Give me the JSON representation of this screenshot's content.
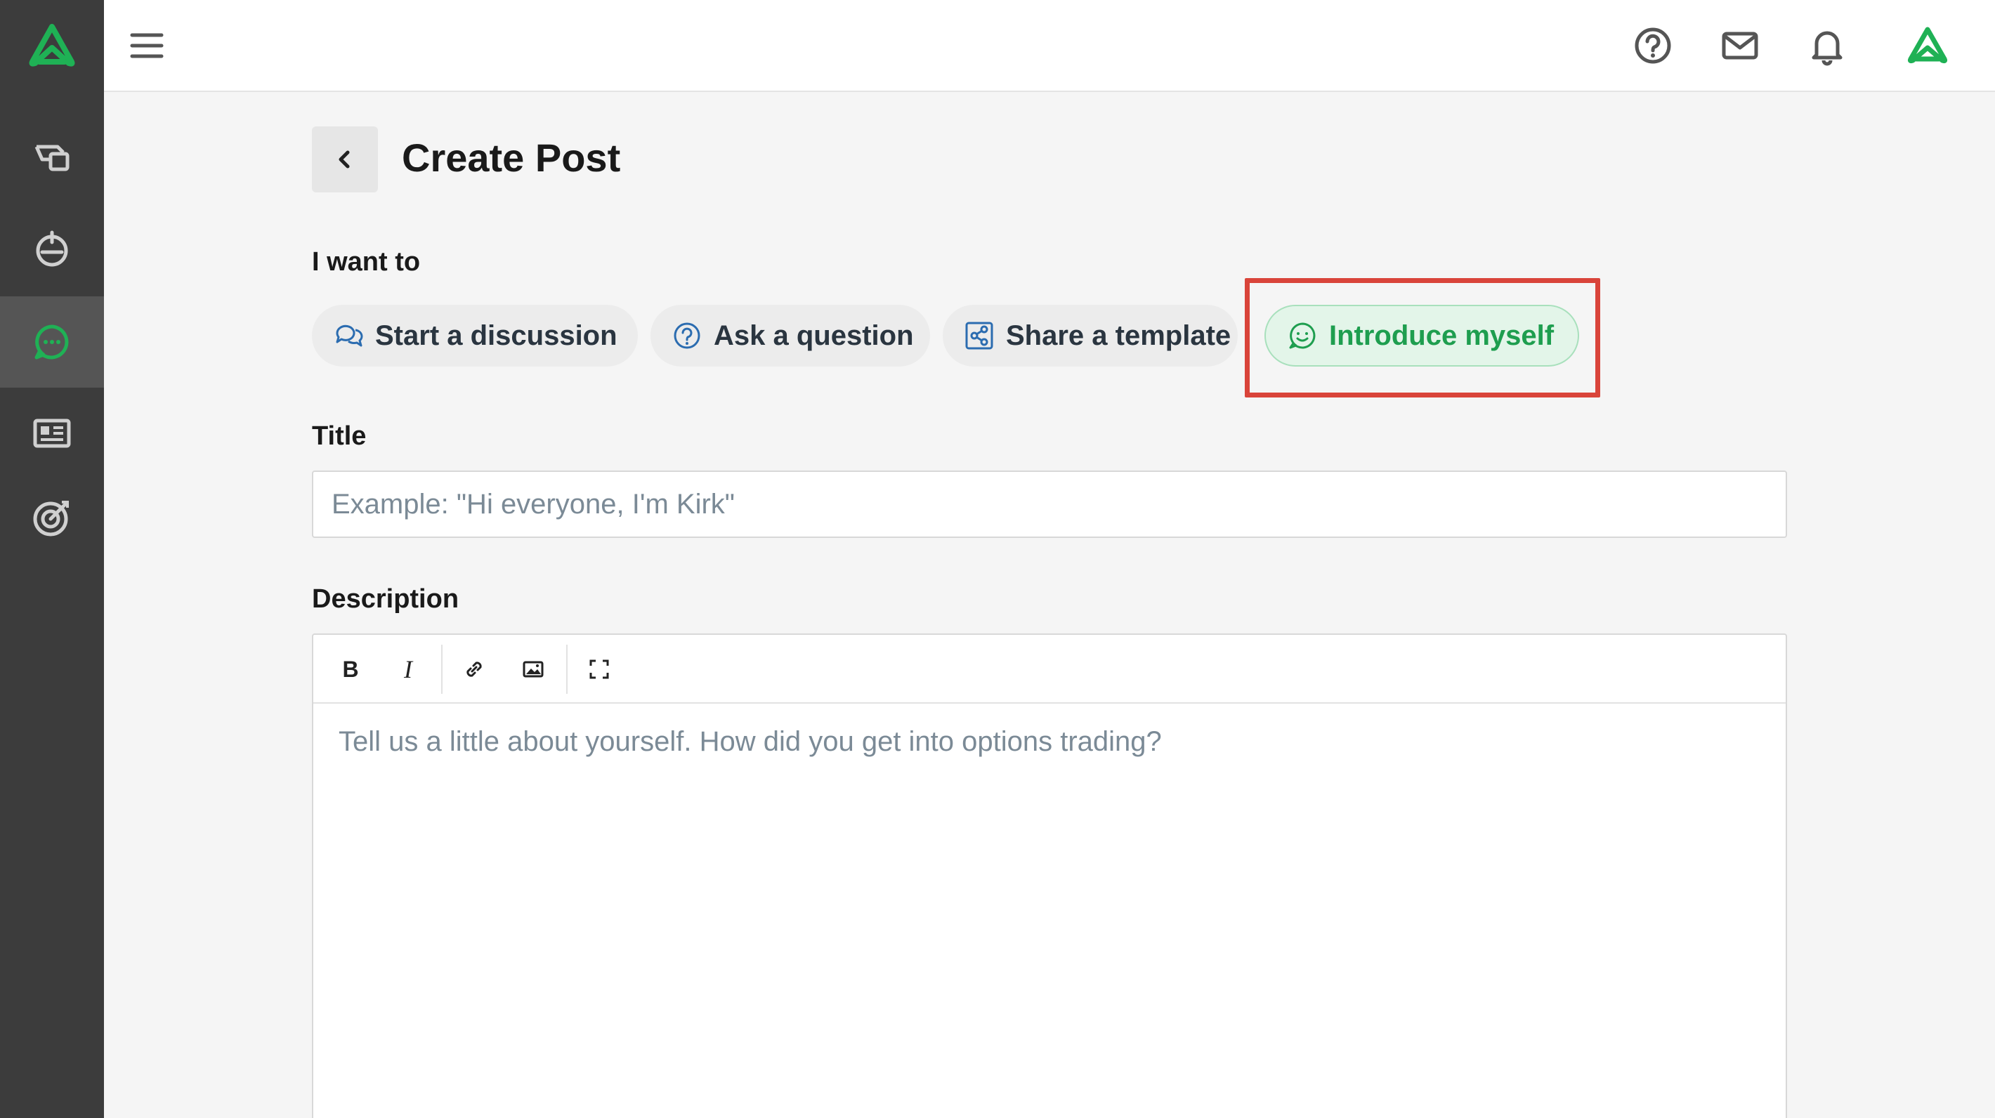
{
  "page": {
    "title": "Create Post",
    "i_want_to_label": "I want to"
  },
  "post_types": [
    {
      "label": "Start a discussion",
      "icon": "chat-bubbles-icon",
      "selected": false
    },
    {
      "label": "Ask a question",
      "icon": "question-circle-icon",
      "selected": false
    },
    {
      "label": "Share a template",
      "icon": "share-icon",
      "selected": false
    },
    {
      "label": "Introduce myself",
      "icon": "smile-chat-icon",
      "selected": true
    }
  ],
  "title_field": {
    "label": "Title",
    "placeholder": "Example: \"Hi everyone, I'm Kirk\"",
    "value": ""
  },
  "description_field": {
    "label": "Description",
    "placeholder": "Tell us a little about yourself. How did you get into options trading?",
    "toolbar": {
      "bold": "B",
      "italic": "I"
    }
  },
  "colors": {
    "brand_green": "#1fb155",
    "sidebar_bg": "#3c3c3c",
    "highlight_red": "#d9443a",
    "selected_chip_bg": "#e3f5e9"
  }
}
